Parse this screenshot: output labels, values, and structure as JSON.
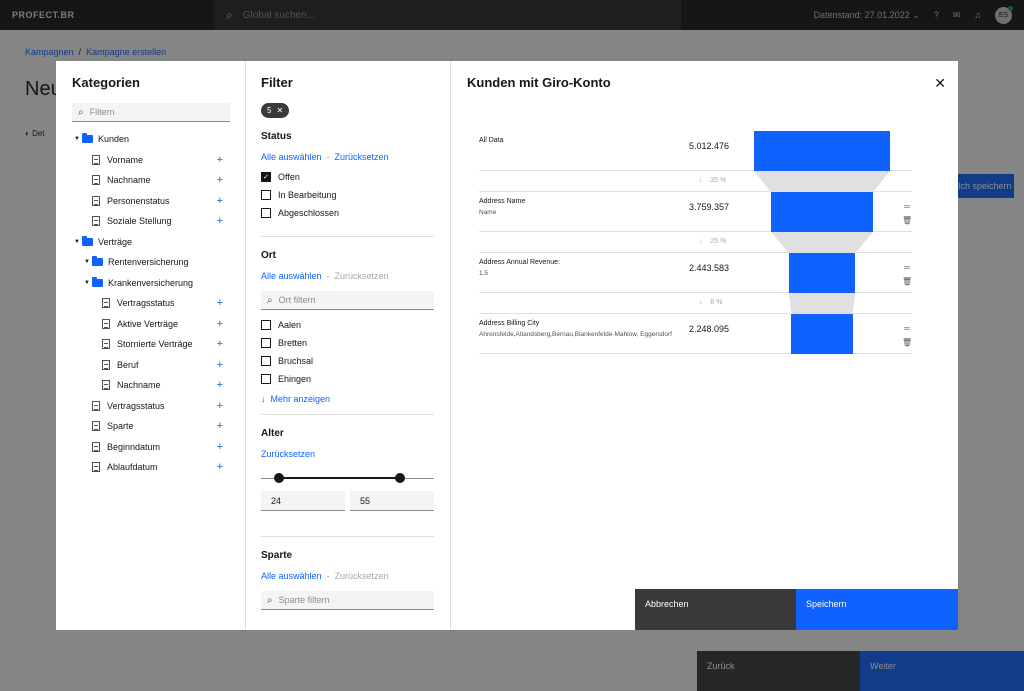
{
  "app": {
    "brand": "PROFECT.BR",
    "search_placeholder": "Global suchen...",
    "stand": "Datenstand: 27.01.2022",
    "avatar": "ES",
    "breadcrumb": [
      "Kampagnen",
      "Kampagne erstellen"
    ],
    "title": "Neu",
    "tab": "Det",
    "save_btn": "Ich speichern",
    "back_btn": "Zurück",
    "next_btn": "Weiter"
  },
  "categories": {
    "title": "Kategorien",
    "search_placeholder": "Filtern",
    "tree": [
      {
        "label": "Kunden",
        "type": "folder",
        "level": 0
      },
      {
        "label": "Vorname",
        "type": "doc",
        "level": 1
      },
      {
        "label": "Nachname",
        "type": "doc",
        "level": 1
      },
      {
        "label": "Personenstatus",
        "type": "doc",
        "level": 1
      },
      {
        "label": "Soziale Stellung",
        "type": "doc",
        "level": 1
      },
      {
        "label": "Verträge",
        "type": "folder",
        "level": 0
      },
      {
        "label": "Rentenversicherung",
        "type": "folder",
        "level": 1
      },
      {
        "label": "Krankenversicherung",
        "type": "folder",
        "level": 1
      },
      {
        "label": "Vertragsstatus",
        "type": "doc",
        "level": 2
      },
      {
        "label": "Aktive Verträge",
        "type": "doc",
        "level": 2
      },
      {
        "label": "Stornierte Verträge",
        "type": "doc",
        "level": 2
      },
      {
        "label": "Beruf",
        "type": "doc",
        "level": 2
      },
      {
        "label": "Nachname",
        "type": "doc",
        "level": 2
      },
      {
        "label": "Vertragsstatus",
        "type": "doc",
        "level": 1
      },
      {
        "label": "Sparte",
        "type": "doc",
        "level": 1
      },
      {
        "label": "Beginndatum",
        "type": "doc",
        "level": 1
      },
      {
        "label": "Ablaufdatum",
        "type": "doc",
        "level": 1
      }
    ]
  },
  "filter": {
    "title": "Filter",
    "chip_count": "5",
    "status": {
      "title": "Status",
      "select_all": "Alle auswählen",
      "reset": "Zurücksetzen",
      "options": [
        {
          "label": "Offen",
          "checked": true
        },
        {
          "label": "In Bearbeitung",
          "checked": false
        },
        {
          "label": "Abgeschlossen",
          "checked": false
        }
      ]
    },
    "ort": {
      "title": "Ort",
      "select_all": "Alle auswählen",
      "reset": "Zurücksetzen",
      "search_placeholder": "Ort filtern",
      "options": [
        {
          "label": "Aalen",
          "checked": false
        },
        {
          "label": "Bretten",
          "checked": false
        },
        {
          "label": "Bruchsal",
          "checked": false
        },
        {
          "label": "Ehingen",
          "checked": false
        }
      ],
      "more": "Mehr anzeigen"
    },
    "alter": {
      "title": "Alter",
      "reset": "Zurücksetzen",
      "min": "24",
      "max": "55"
    },
    "sparte": {
      "title": "Sparte",
      "select_all": "Alle auswählen",
      "reset": "Zurücksetzen",
      "search_placeholder": "Sparte filtern"
    }
  },
  "funnel": {
    "title": "Kunden mit Giro-Konto",
    "stages": [
      {
        "label": "All Data",
        "sub": "",
        "value": "5.012.476",
        "bar_fraction": 1.0,
        "actions": false
      },
      {
        "label": "Address Name",
        "sub": "Name",
        "value": "3.759.357",
        "bar_fraction": 0.75,
        "actions": true
      },
      {
        "label": "Address Annual Revenue:",
        "sub": "1.5",
        "value": "2.443.583",
        "bar_fraction": 0.49,
        "actions": true
      },
      {
        "label": "Address Billing City",
        "sub": "Ahrensfelde,Atlandsberg,Bernau,Blankenfelde-Mahlow, Eggersdorf",
        "value": "2.248.095",
        "bar_fraction": 0.45,
        "actions": true
      }
    ],
    "drops": [
      "35 %",
      "25 %",
      "8 %"
    ],
    "cancel": "Abbrechen",
    "save": "Speichern"
  }
}
